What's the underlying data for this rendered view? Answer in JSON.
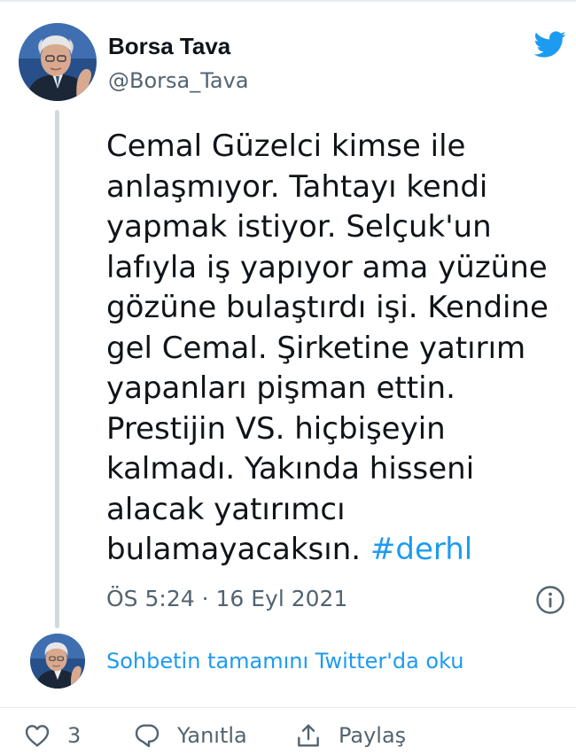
{
  "tweet": {
    "author": {
      "display_name": "Borsa Tava",
      "handle": "@Borsa_Tava"
    },
    "text": "Cemal Güzelci kimse ile\nanlaşmıyor. Tahtayı kendi\nyapmak istiyor. Selçuk'un\nlafıyla iş yapıyor ama yüzüne\ngözüne bulaştırdı işi. Kendine\ngel Cemal. Şirketine yatırım\nyapanları pişman ettin.\nPrestijin VS. hiçbişeyin\nkalmadı. Yakında hisseni\nalacak yatırımcı\nbulamayacaksın. ",
    "hashtag": "#derhl",
    "timestamp": "ÖS 5:24 · 16 Eyl 2021",
    "conversation_link": "Sohbetin tamamını Twitter'da oku"
  },
  "actions": {
    "like_count": "3",
    "reply_label": "Yanıtla",
    "share_label": "Paylaş"
  },
  "icons": {
    "brand": "twitter-bird-icon",
    "info": "info-icon",
    "like": "heart-icon",
    "reply": "reply-icon",
    "share": "share-icon"
  },
  "colors": {
    "accent": "#1d9bf0",
    "text": "#0f1419",
    "muted": "#536471",
    "thread_line": "#cfd9de"
  }
}
